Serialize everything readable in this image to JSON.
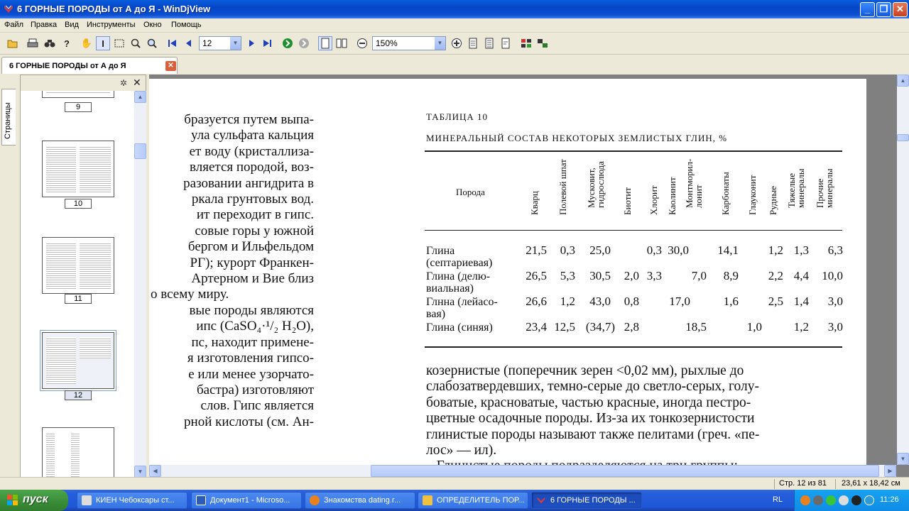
{
  "window": {
    "title": "6 ГОРНЫЕ ПОРОДЫ от А до Я - WinDjView",
    "minimize": "_",
    "maximize": "❐",
    "close": "✕"
  },
  "menu": [
    "Файл",
    "Правка",
    "Вид",
    "Инструменты",
    "Окно",
    "Помощь"
  ],
  "toolbar": {
    "page_value": "12",
    "zoom_value": "150%"
  },
  "tab": {
    "label": "6 ГОРНЫЕ ПОРОДЫ от А до Я",
    "close": "✕"
  },
  "sidebar": {
    "tab_label": "Страницы",
    "gear": "✲",
    "close": "✕",
    "thumbnails": [
      {
        "page": "9"
      },
      {
        "page": "10"
      },
      {
        "page": "11"
      },
      {
        "page": "12"
      }
    ]
  },
  "document": {
    "left_column": [
      "бразуется путем выпа-",
      "ула сульфата кальция",
      "ет воду (кристаллиза-",
      "вляется породой, воз-",
      "разовании ангидрита в",
      "ркала грунтовых вод.",
      "ит переходит в гипс.",
      "совые горы у южной",
      "бергом и Ильфельдом",
      "РГ); курорт Франкен-",
      "Артерном и Вие близ",
      "о всему миру.",
      "вые породы являются",
      "ипс (CaSO₄·¹/₂ H₂O),",
      "пс, находит примене-",
      "я изготовления гипсо-",
      "е или менее узорчато-",
      "бастра)   изготовляют",
      "слов. Гипс является",
      "рной кислоты (см. Ан-"
    ],
    "table_label": "ТАБЛИЦА 10",
    "table_title": "МИНЕРАЛЬНЫЙ СОСТАВ НЕКОТОРЫХ ЗЕМЛИСТЫХ ГЛИН, %",
    "row_header": "Порода",
    "columns": [
      "Кварц",
      "Полевой шпат",
      "Мусковит, гидрослюда",
      "Биотит",
      "Хлорит",
      "Каолинит",
      "Монтморил-лонит",
      "Карбонаты",
      "Глауконит",
      "Рудные",
      "Тяжелые минералы",
      "Прочие минералы"
    ],
    "rows": [
      {
        "name1": "Глина",
        "name2": "(септариевая)",
        "c0": "21,5",
        "c1": "0,3",
        "c2": "25,0",
        "c3": "",
        "c4": "0,3",
        "c5": "30,0",
        "c6": "",
        "c7": "14,1",
        "c8": "",
        "c9": "1,2",
        "c10": "1,3",
        "c11": "6,3"
      },
      {
        "name1": "Глина (делю-",
        "name2": "виальная)",
        "c0": "26,5",
        "c1": "5,3",
        "c2": "30,5",
        "c3": "2,0",
        "c4": "3,3",
        "c5": "",
        "c6": "7,0",
        "c7": "8,9",
        "c8": "",
        "c9": "2,2",
        "c10": "4,4",
        "c11": "10,0"
      },
      {
        "name1": "Глнна (лейасо-",
        "name2": "вая)",
        "c0": "26,6",
        "c1": "1,2",
        "c2": "43,0",
        "c3": "0,8",
        "c4": "",
        "c5": "17,0",
        "c6": "",
        "c7": "1,6",
        "c8": "",
        "c9": "2,5",
        "c10": "1,4",
        "c11": "3,0"
      },
      {
        "name1": "Глина (синяя)",
        "name2": "",
        "c0": "23,4",
        "c1": "12,5",
        "c2": "(34,7)",
        "c3": "2,8",
        "c4": "",
        "c5": "",
        "c6": "18,5",
        "c7": "",
        "c8": "1,0",
        "c9": "",
        "c10": "1,2",
        "c11": "3,0"
      }
    ],
    "body_lines": [
      "козернистые (поперечник зерен <0,02 мм), рыхлые до",
      "слабозатвердевших, темно-серые до светло-серых, голу-",
      "боватые, красноватые, частью красные, иногда пестро-",
      "цветные осадочные породы. Из-за их тонкозернистости",
      "глинистые породы называют также пелитами (греч. «пе-",
      "лос» — ил).",
      "   Глинистые породы подразделяются на три группы:"
    ]
  },
  "status": {
    "page_info": "Стр. 12 из 81",
    "page_size": "23,61 x 18,42 см"
  },
  "taskbar": {
    "start": "пуск",
    "tasks": [
      "КИЕН Чебоксары ст...",
      "Документ1 - Microso...",
      "Знакомства dating.r...",
      "ОПРЕДЕЛИТЕЛЬ ПОР...",
      "6 ГОРНЫЕ ПОРОДЫ ..."
    ],
    "lang": "RL",
    "clock": "11:26"
  }
}
